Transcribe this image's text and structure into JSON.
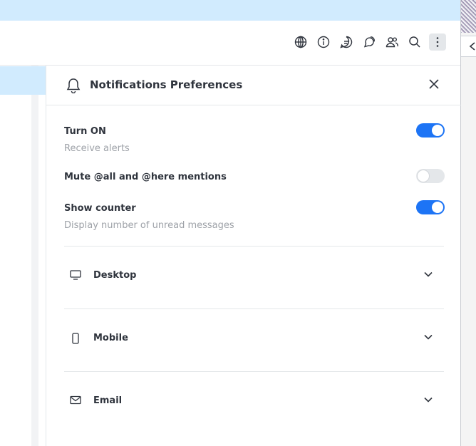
{
  "panel": {
    "title": "Notifications Preferences"
  },
  "settings": [
    {
      "title": "Turn ON",
      "subtitle": "Receive alerts",
      "enabled": true
    },
    {
      "title": "Mute @all and @here mentions",
      "subtitle": "",
      "enabled": false
    },
    {
      "title": "Show counter",
      "subtitle": "Display number of unread messages",
      "enabled": true
    }
  ],
  "sections": [
    {
      "label": "Desktop",
      "icon": "desktop-icon"
    },
    {
      "label": "Mobile",
      "icon": "mobile-icon"
    },
    {
      "label": "Email",
      "icon": "mail-icon"
    }
  ],
  "toolbar": {
    "icons": [
      "globe-icon",
      "info-icon",
      "threads-icon",
      "discussions-icon",
      "members-icon",
      "search-icon",
      "kebab-icon"
    ]
  },
  "colors": {
    "accent": "#1d74f5",
    "banner": "#d1ebfe",
    "text": "#2f343d",
    "muted": "#9ea2a8"
  }
}
